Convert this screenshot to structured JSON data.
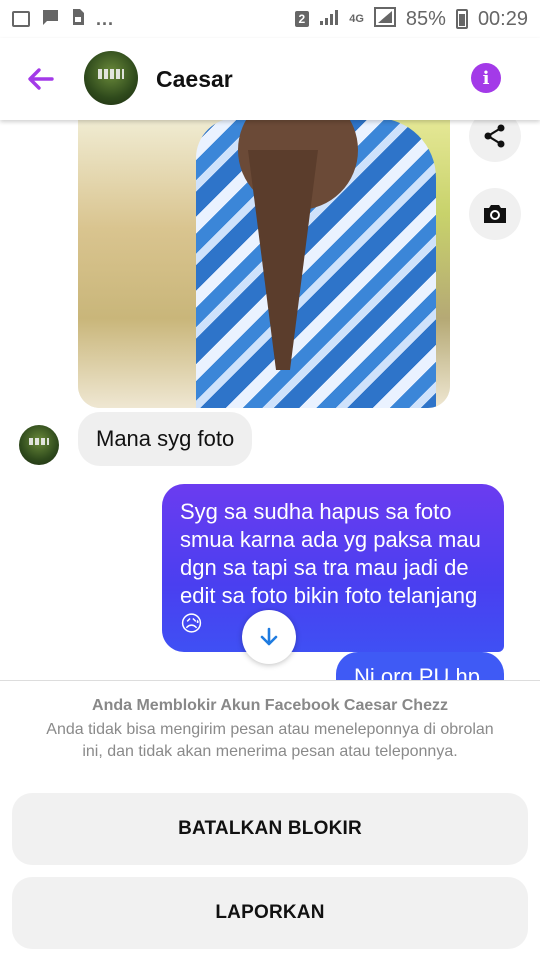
{
  "status_bar": {
    "sim_badge": "2",
    "network": "4G",
    "battery": "85%",
    "time": "00:29",
    "more": "...",
    "icons": [
      "image-icon",
      "message-icon",
      "sim-icon",
      "signal-icon",
      "battery-icon"
    ]
  },
  "header": {
    "contact_name": "Caesar",
    "accent_color": "#a33ae8",
    "icons": [
      "back-arrow-icon",
      "info-icon"
    ]
  },
  "messages": {
    "incoming": [
      {
        "text": "Mana syg foto"
      }
    ],
    "outgoing": [
      {
        "text": "Syg sa sudha hapus sa foto smua karna ada yg paksa mau dgn sa tapi sa tra mau jadi de edit sa foto bikin foto telanjang 😥"
      },
      {
        "text": "Ni org PU hp"
      }
    ],
    "outgoing_color": "#4a3ff0",
    "icons": [
      "share-icon",
      "camera-icon",
      "arrow-down-icon"
    ]
  },
  "block_panel": {
    "title": "Anda Memblokir Akun Facebook Caesar Chezz",
    "description": "Anda tidak bisa mengirim pesan atau meneleponnya di obrolan ini, dan tidak akan menerima pesan atau teleponnya.",
    "unblock_label": "BATALKAN BLOKIR",
    "report_label": "LAPORKAN"
  }
}
